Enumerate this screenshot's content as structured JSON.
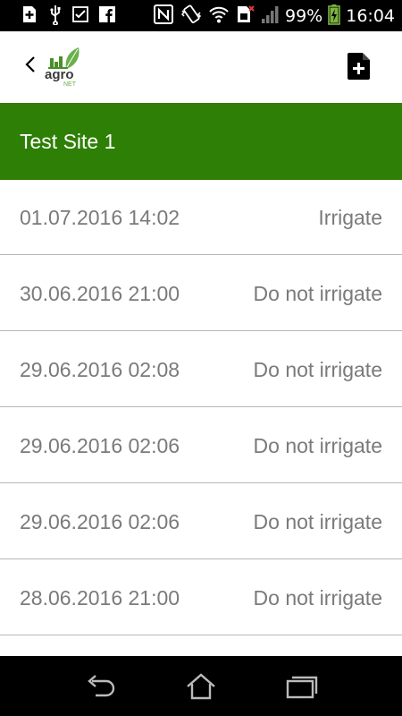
{
  "status_bar": {
    "battery_percent": "99%",
    "time": "16:04",
    "icons": [
      "add-icon",
      "usb-icon",
      "checkbox-icon",
      "facebook-icon",
      "nfc-icon",
      "vibrate-icon",
      "wifi-icon",
      "sim-icon",
      "signal-icon",
      "battery-icon"
    ]
  },
  "app_bar": {
    "logo_text": "agro",
    "logo_subtext": "NET",
    "back_icon": "chevron-left-icon",
    "add_icon": "add-document-icon"
  },
  "site": {
    "title": "Test Site 1"
  },
  "readings": [
    {
      "date": "01.07.2016 14:02",
      "status": "Irrigate"
    },
    {
      "date": "30.06.2016 21:00",
      "status": "Do not irrigate"
    },
    {
      "date": "29.06.2016 02:08",
      "status": "Do not irrigate"
    },
    {
      "date": "29.06.2016 02:06",
      "status": "Do not irrigate"
    },
    {
      "date": "29.06.2016 02:06",
      "status": "Do not irrigate"
    },
    {
      "date": "28.06.2016 21:00",
      "status": "Do not irrigate"
    }
  ],
  "nav_bar": {
    "icons": [
      "back-icon",
      "home-icon",
      "recent-apps-icon"
    ]
  },
  "colors": {
    "header_green": "#2d7f05",
    "text_gray": "#7a7a7a",
    "logo_green": "#4a8f2a"
  }
}
